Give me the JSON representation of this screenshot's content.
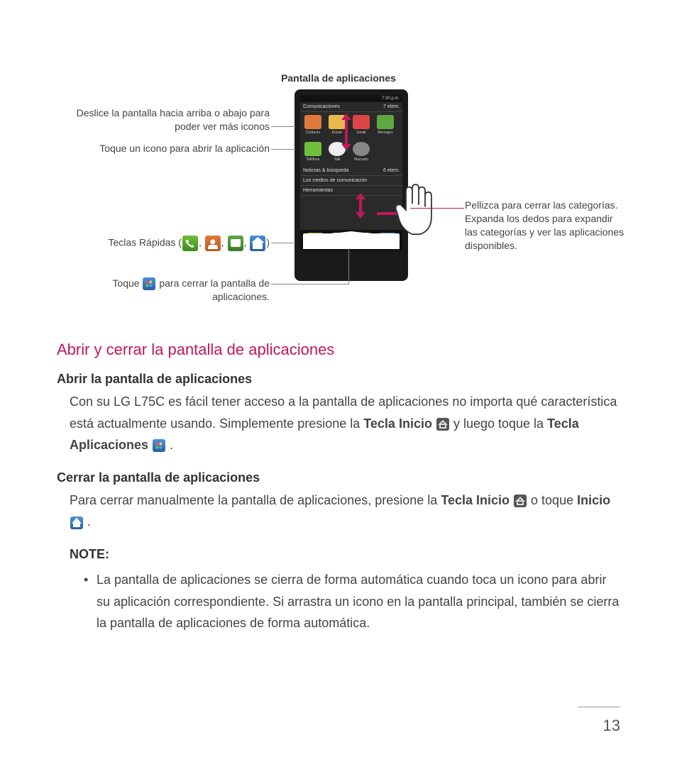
{
  "diagram": {
    "title": "Pantalla de aplicaciones",
    "callout_swipe": "Deslice la pantalla hacia arriba o abajo para poder ver más iconos",
    "callout_tap": "Toque un icono para abrir la aplicación",
    "callout_quick_prefix": "Teclas Rápidas (",
    "callout_quick_suffix": ")",
    "callout_close_prefix": "Toque",
    "callout_close_suffix": "para cerrar la pantalla de aplicaciones.",
    "callout_pinch": "Pellizca para cerrar las categorías. Expanda los dedos para expandir las categorías y ver las aplicaciones disponibles.",
    "statusbar_time": "7:30 p.m.",
    "cat1": "Comunicaciones",
    "cat1_count": "7 elem.",
    "cat2": "Noticias & búsqueda",
    "cat2_count": "6 elem.",
    "cat3": "Los medios de comunicación",
    "cat4": "Herramientas"
  },
  "section": {
    "heading": "Abrir y cerrar la pantalla de aplicaciones",
    "open_heading": "Abrir la pantalla de aplicaciones",
    "open_text_a": "Con su LG L75C es fácil tener acceso a la pantalla de aplicaciones no importa qué característica está actualmente usando. Simplemente presione la ",
    "open_bold_home": "Tecla Inicio",
    "open_text_b": " y luego toque la ",
    "open_bold_apps": "Tecla Aplicaciones",
    "open_text_c": " .",
    "close_heading": "Cerrar la pantalla de aplicaciones",
    "close_text_a": "Para cerrar manualmente la pantalla de aplicaciones, presione la ",
    "close_bold_home": "Tecla Inicio",
    "close_text_b": " o toque ",
    "close_bold_inicio": "Inicio",
    "close_text_c": " .",
    "note_label": "NOTE:",
    "note_text": "La pantalla de aplicaciones se cierra de forma automática cuando toca un icono para abrir su aplicación correspondiente. Si arrastra un icono en la pantalla principal, también se cierra la pantalla de aplicaciones de forma automática."
  },
  "page_number": "13"
}
